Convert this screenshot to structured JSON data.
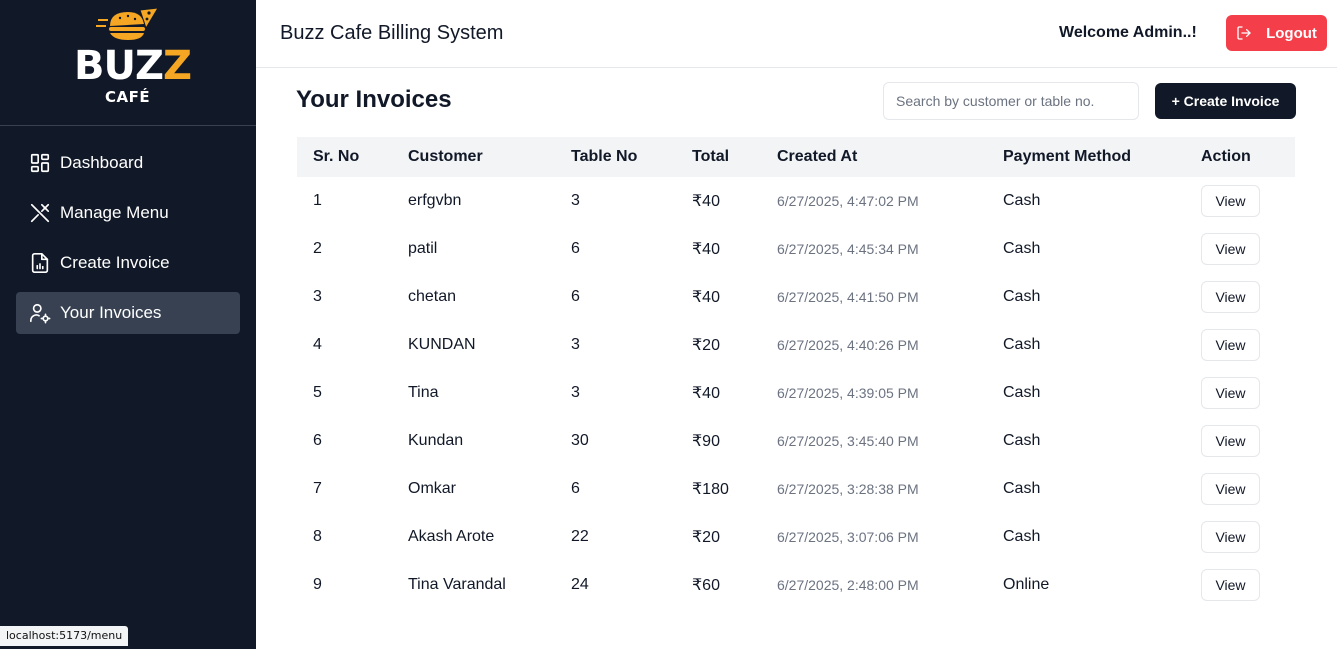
{
  "brand": {
    "name_main": "BUZ",
    "name_accent": "Z",
    "sub": "CAFÉ",
    "accent_color": "#f5a623"
  },
  "sidebar": {
    "items": [
      {
        "label": "Dashboard",
        "icon": "dashboard-grid-icon"
      },
      {
        "label": "Manage Menu",
        "icon": "utensils-icon"
      },
      {
        "label": "Create Invoice",
        "icon": "invoice-file-icon"
      },
      {
        "label": "Your Invoices",
        "icon": "user-settings-icon",
        "active": true
      }
    ]
  },
  "status_bar": {
    "url": "localhost:5173/menu"
  },
  "header": {
    "title": "Buzz Cafe Billing System",
    "welcome": "Welcome Admin..!",
    "logout_label": "Logout",
    "logout_color": "#f43f4a"
  },
  "main": {
    "title": "Your Invoices",
    "search": {
      "placeholder": "Search by customer or table no.",
      "value": ""
    },
    "create_label": "+ Create Invoice"
  },
  "table": {
    "columns": [
      "Sr. No",
      "Customer",
      "Table No",
      "Total",
      "Created At",
      "Payment Method",
      "Action"
    ],
    "view_label": "View",
    "rows": [
      {
        "sr": "1",
        "customer": "erfgvbn",
        "table": "3",
        "total": "₹40",
        "created": "6/27/2025, 4:47:02 PM",
        "payment": "Cash"
      },
      {
        "sr": "2",
        "customer": "patil",
        "table": "6",
        "total": "₹40",
        "created": "6/27/2025, 4:45:34 PM",
        "payment": "Cash"
      },
      {
        "sr": "3",
        "customer": "chetan",
        "table": "6",
        "total": "₹40",
        "created": "6/27/2025, 4:41:50 PM",
        "payment": "Cash"
      },
      {
        "sr": "4",
        "customer": "KUNDAN",
        "table": "3",
        "total": "₹20",
        "created": "6/27/2025, 4:40:26 PM",
        "payment": "Cash"
      },
      {
        "sr": "5",
        "customer": "Tina",
        "table": "3",
        "total": "₹40",
        "created": "6/27/2025, 4:39:05 PM",
        "payment": "Cash"
      },
      {
        "sr": "6",
        "customer": "Kundan",
        "table": "30",
        "total": "₹90",
        "created": "6/27/2025, 3:45:40 PM",
        "payment": "Cash"
      },
      {
        "sr": "7",
        "customer": "Omkar",
        "table": "6",
        "total": "₹180",
        "created": "6/27/2025, 3:28:38 PM",
        "payment": "Cash"
      },
      {
        "sr": "8",
        "customer": "Akash Arote",
        "table": "22",
        "total": "₹20",
        "created": "6/27/2025, 3:07:06 PM",
        "payment": "Cash"
      },
      {
        "sr": "9",
        "customer": "Tina Varandal",
        "table": "24",
        "total": "₹60",
        "created": "6/27/2025, 2:48:00 PM",
        "payment": "Online"
      }
    ]
  }
}
